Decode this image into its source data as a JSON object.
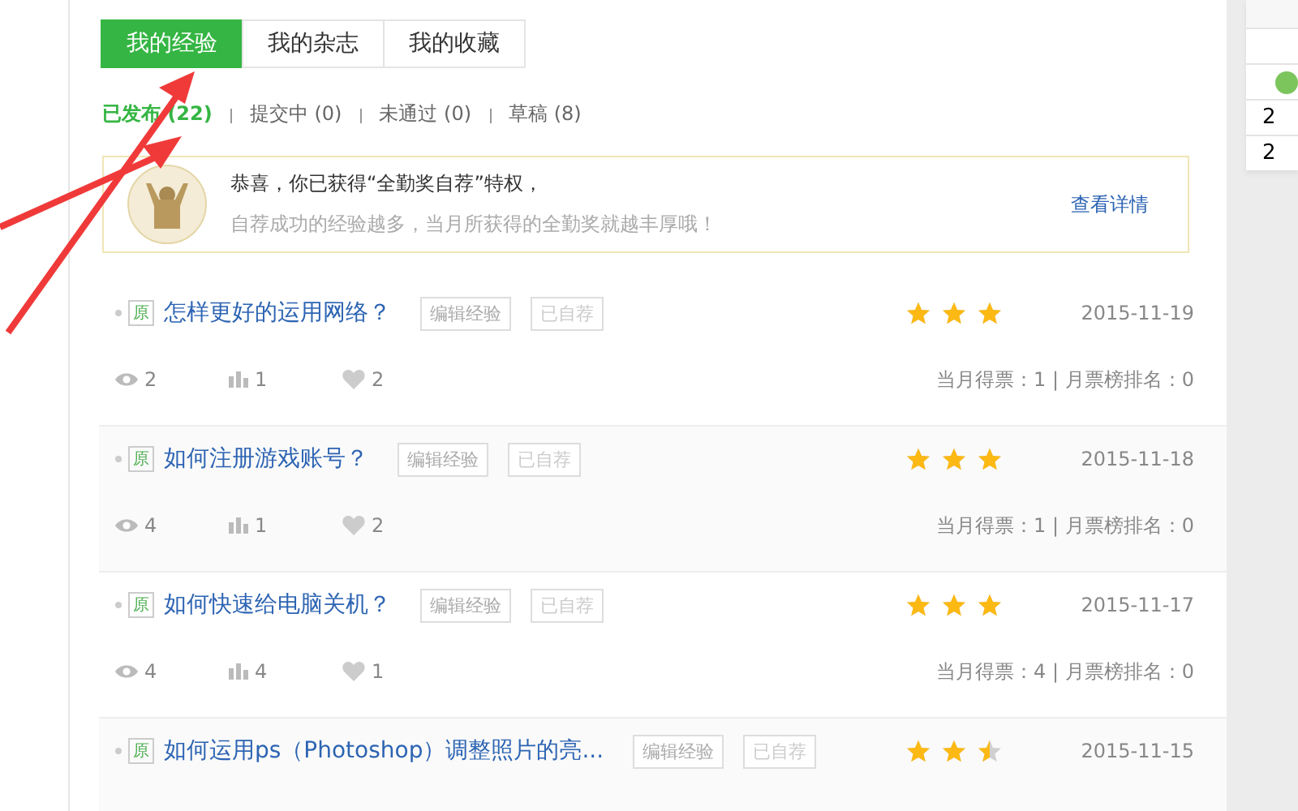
{
  "tabs": [
    {
      "label": "我的经验",
      "selected": true
    },
    {
      "label": "我的杂志",
      "selected": false
    },
    {
      "label": "我的收藏",
      "selected": false
    }
  ],
  "filters": [
    {
      "label": "已发布",
      "count": "(22)",
      "selected": true
    },
    {
      "label": "提交中",
      "count": "(0)",
      "selected": false
    },
    {
      "label": "未通过",
      "count": "(0)",
      "selected": false
    },
    {
      "label": "草稿",
      "count": "(8)",
      "selected": false
    }
  ],
  "banner": {
    "title": "恭喜，你已获得“全勤奖自荐”特权，",
    "subtitle": "自荐成功的经验越多，当月所获得的全勤奖就越丰厚哦！",
    "link": "查看详情"
  },
  "articles": [
    {
      "badge": "原",
      "title": "怎样更好的运用网络？",
      "edit": "编辑经验",
      "recommended": "已自荐",
      "stars": 3,
      "date": "2015-11-19",
      "views": "2",
      "votes": "1",
      "likes": "2",
      "stats": "当月得票：1 | 月票榜排名：0"
    },
    {
      "badge": "原",
      "title": "如何注册游戏账号？",
      "edit": "编辑经验",
      "recommended": "已自荐",
      "stars": 3,
      "date": "2015-11-18",
      "views": "4",
      "votes": "1",
      "likes": "2",
      "stats": "当月得票：1 | 月票榜排名：0"
    },
    {
      "badge": "原",
      "title": "如何快速给电脑关机？",
      "edit": "编辑经验",
      "recommended": "已自荐",
      "stars": 3,
      "date": "2015-11-17",
      "views": "4",
      "votes": "4",
      "likes": "1",
      "stats": "当月得票：4 | 月票榜排名：0"
    },
    {
      "badge": "原",
      "title": "如何运用ps（Photoshop）调整照片的亮...",
      "edit": "编辑经验",
      "recommended": "已自荐",
      "stars": 2.5,
      "date": "2015-11-15"
    }
  ],
  "side_panel": {
    "rows": [
      "2",
      "2"
    ]
  }
}
